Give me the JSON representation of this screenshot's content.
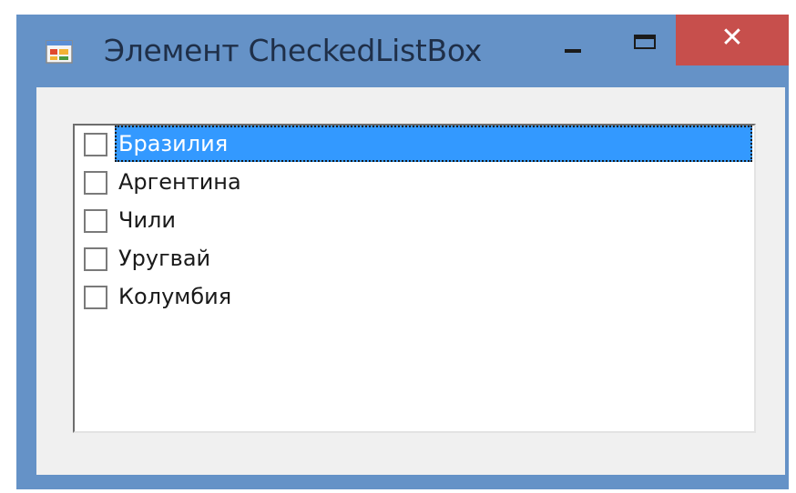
{
  "window": {
    "title": "Элемент CheckedListBox",
    "icon": "winforms-app-icon",
    "buttons": {
      "minimize": "minimize-icon",
      "maximize": "maximize-icon",
      "close": "✕"
    }
  },
  "listbox": {
    "items": [
      {
        "label": "Бразилия",
        "checked": false,
        "selected": true
      },
      {
        "label": "Аргентина",
        "checked": false,
        "selected": false
      },
      {
        "label": "Чили",
        "checked": false,
        "selected": false
      },
      {
        "label": "Уругвай",
        "checked": false,
        "selected": false
      },
      {
        "label": "Колумбия",
        "checked": false,
        "selected": false
      }
    ]
  },
  "colors": {
    "frame": "#6592c7",
    "close_button": "#c74f4c",
    "selection": "#3399ff",
    "client": "#f0f0f0"
  }
}
